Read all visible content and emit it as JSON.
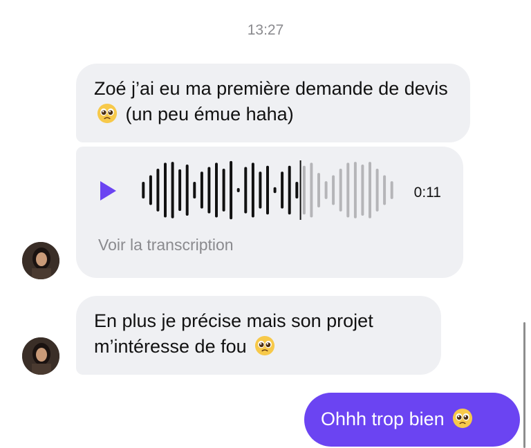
{
  "timestamp": "13:27",
  "messages": [
    {
      "type": "text",
      "direction": "incoming",
      "text_before": "Zoé j’ai eu ma première demande de devis",
      "emoji": "pleading-face",
      "text_after": "(un peu émue haha)"
    },
    {
      "type": "audio",
      "direction": "incoming",
      "duration": "0:11",
      "progress": 0.62,
      "transcript_link": "Voir la transcription"
    },
    {
      "type": "text",
      "direction": "incoming",
      "text_before": "En plus je précise mais son projet m’intéresse de fou",
      "emoji": "pleading-face"
    },
    {
      "type": "text",
      "direction": "outgoing",
      "text_before": "Ohhh trop bien",
      "emoji": "pleading-face"
    }
  ],
  "colors": {
    "incoming_bubble": "#eff0f3",
    "outgoing_bubble": "#6b44f2",
    "accent": "#6b44f2",
    "muted_text": "#8a8a8e"
  },
  "waveform_levels": [
    0.28,
    0.5,
    0.72,
    0.92,
    0.95,
    0.7,
    0.86,
    0.28,
    0.62,
    0.78,
    0.92,
    0.72,
    0.98,
    0.06,
    0.78,
    0.92,
    0.62,
    0.82,
    0.1,
    0.62,
    0.82,
    0.28,
    0.82,
    0.92,
    0.58,
    0.3,
    0.5,
    0.72,
    0.92,
    0.95,
    0.86,
    0.95,
    0.72,
    0.5,
    0.3
  ]
}
